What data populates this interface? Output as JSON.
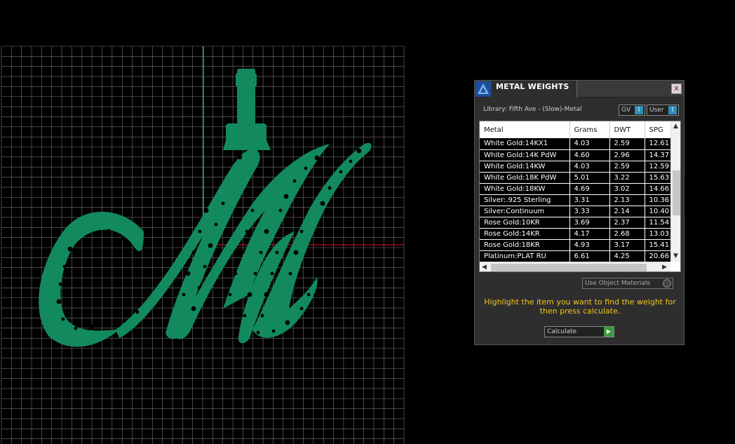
{
  "panel": {
    "title": "METAL WEIGHTS",
    "close_label": "x",
    "library_label": "Library: Fifth Ave - (Slow)-Metal",
    "toggle_gv": "GV",
    "toggle_user": "User",
    "toggle_knob": "I",
    "columns": [
      "Metal",
      "Grams",
      "DWT",
      "SPG"
    ],
    "rows": [
      [
        "White Gold:14KX1",
        "4.03",
        "2.59",
        "12.61"
      ],
      [
        "White Gold:14K PdW",
        "4.60",
        "2.96",
        "14.37"
      ],
      [
        "White Gold:14KW",
        "4.03",
        "2.59",
        "12.59"
      ],
      [
        "White Gold:18K PdW",
        "5.01",
        "3.22",
        "15.63"
      ],
      [
        "White Gold:18KW",
        "4.69",
        "3.02",
        "14.66"
      ],
      [
        "Silver:.925 Sterling",
        "3.31",
        "2.13",
        "10.36"
      ],
      [
        "Silver:Continuum",
        "3.33",
        "2.14",
        "10.40"
      ],
      [
        "Rose Gold:10KR",
        "3.69",
        "2.37",
        "11.54"
      ],
      [
        "Rose Gold:14KR",
        "4.17",
        "2.68",
        "13.03"
      ],
      [
        "Rose Gold:18KR",
        "4.93",
        "3.17",
        "15.41"
      ],
      [
        "Platinum:PLAT RU",
        "6.61",
        "4.25",
        "20.66"
      ]
    ],
    "use_object_materials": "Use Object Materials",
    "instruction": "Highlight the item you want to find the weight for then press calculate.",
    "calculate_label": "Calculate",
    "calculate_arrow": "▶"
  },
  "colors": {
    "model_green": "#128a5e",
    "grid_line": "#8a8a8a",
    "axis_x": "#c0101a",
    "axis_y": "#3aa6b0",
    "instruction_text": "#f2c51c",
    "panel_bg": "#2e2e2e"
  }
}
